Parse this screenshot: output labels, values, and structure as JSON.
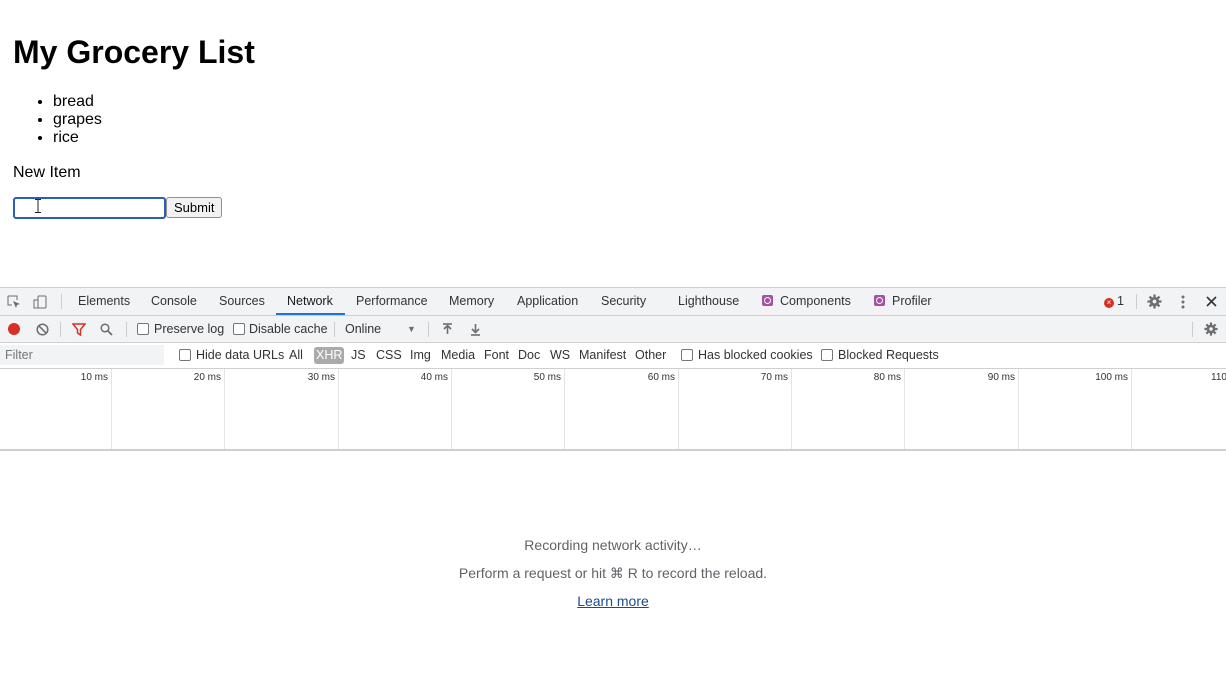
{
  "page": {
    "title": "My Grocery List",
    "items": [
      "bread",
      "grapes",
      "rice"
    ],
    "new_item_label": "New Item",
    "input_value": "",
    "submit_label": "Submit"
  },
  "devtools": {
    "tabs": [
      "Elements",
      "Console",
      "Sources",
      "Network",
      "Performance",
      "Memory",
      "Application",
      "Security",
      "Lighthouse",
      "Components",
      "Profiler"
    ],
    "active_tab": "Network",
    "error_count": "1",
    "toolbar": {
      "preserve_log": "Preserve log",
      "disable_cache": "Disable cache",
      "throttling": "Online"
    },
    "filter": {
      "placeholder": "Filter",
      "hide_data_urls": "Hide data URLs",
      "types": [
        "All",
        "XHR",
        "JS",
        "CSS",
        "Img",
        "Media",
        "Font",
        "Doc",
        "WS",
        "Manifest",
        "Other"
      ],
      "selected_type": "XHR",
      "has_blocked_cookies": "Has blocked cookies",
      "blocked_requests": "Blocked Requests"
    },
    "timeline_ticks": [
      "10 ms",
      "20 ms",
      "30 ms",
      "40 ms",
      "50 ms",
      "60 ms",
      "70 ms",
      "80 ms",
      "90 ms",
      "100 ms",
      "110"
    ],
    "empty_state": {
      "recording": "Recording network activity…",
      "hint": "Perform a request or hit ⌘ R to record the reload.",
      "learn_more": "Learn more"
    },
    "colors": {
      "record": "#d93025",
      "accent": "#1a73e8",
      "filter_icon": "#d93025",
      "react_badge": "#a450a6",
      "error": "#d93025"
    }
  }
}
